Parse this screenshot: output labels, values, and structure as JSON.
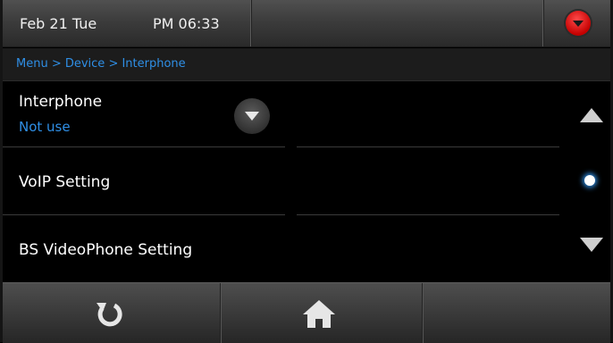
{
  "status": {
    "date": "Feb 21 Tue",
    "time": "PM 06:33"
  },
  "breadcrumb": "Menu > Device > Interphone",
  "items": [
    {
      "label": "Interphone",
      "value": "Not use"
    },
    {
      "label": "VoIP Setting"
    },
    {
      "label": "BS VideoPhone Setting"
    }
  ],
  "colors": {
    "accent": "#2f8fe6",
    "alert": "#d40000",
    "background": "#000000"
  },
  "icons": {
    "top_right": "dropdown-icon",
    "scroll_up": "arrow-up-icon",
    "scroll_down": "arrow-down-icon",
    "back": "back-icon",
    "home": "home-icon"
  }
}
